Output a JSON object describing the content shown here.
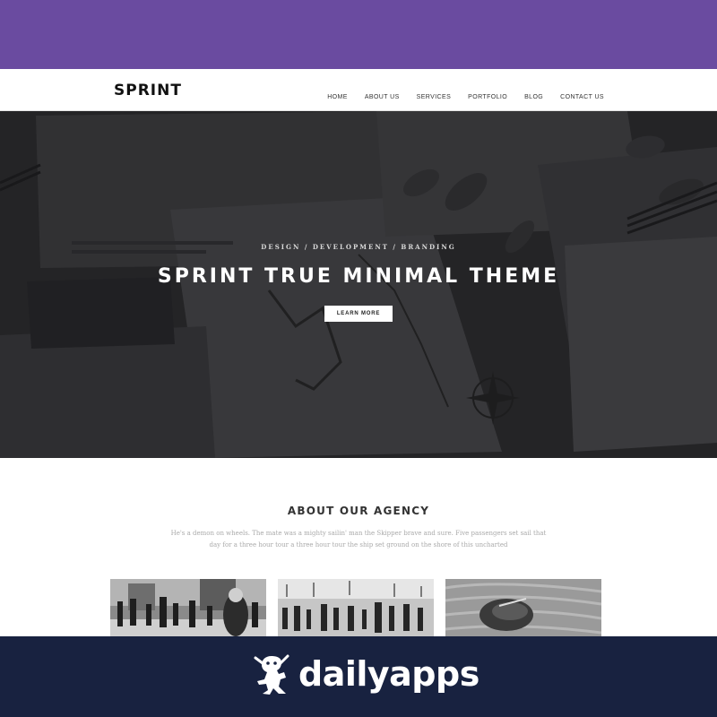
{
  "colors": {
    "top_band": "#6a4ba0",
    "bottom_band": "#182240",
    "hero_bg": "#2a2a2c",
    "button_bg": "#ffffff"
  },
  "header": {
    "logo": "SPRINT",
    "nav": [
      "HOME",
      "ABOUT US",
      "SERVICES",
      "PORTFOLIO",
      "BLOG",
      "CONTACT US"
    ]
  },
  "hero": {
    "subtitle": "DESIGN / DEVELOPMENT / BRANDING",
    "title": "SPRINT TRUE MINIMAL THEME",
    "button_label": "LEARN MORE"
  },
  "about": {
    "title": "ABOUT OUR AGENCY",
    "text_line1": "He's a demon on wheels. The mate was a mighty sailin' man the Skipper brave and sure. Five passengers set sail that",
    "text_line2": "day for a three hour tour a three hour tour the ship set ground on the shore of this uncharted"
  },
  "gallery": [
    "street-crowd-photo",
    "pier-crowd-photo",
    "shoes-photo"
  ],
  "footer_brand": {
    "name": "dailyapps",
    "icon": "frog-logo-icon"
  }
}
